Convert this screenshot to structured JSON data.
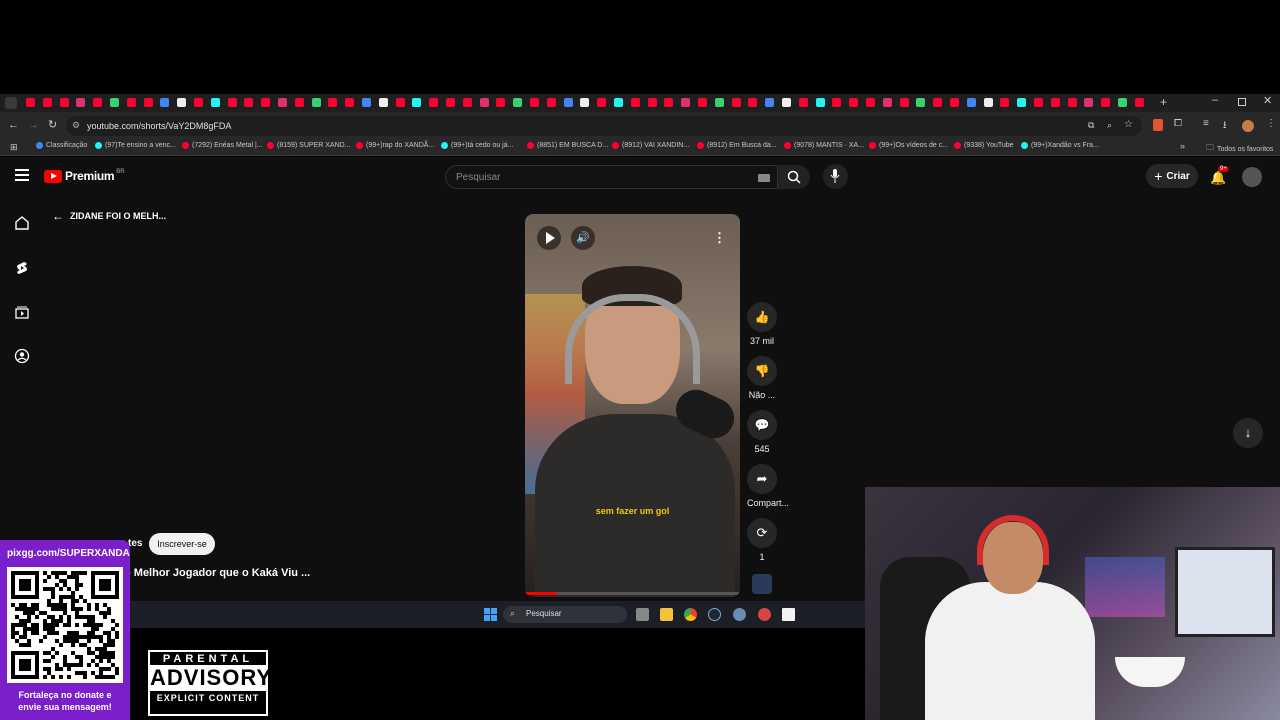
{
  "browser": {
    "url": "youtube.com/shorts/VaY2DM8gFDA",
    "bookmarks": [
      "Classificação",
      "(97)Te ensino a venc...",
      "(7292) Enéas Metal |...",
      "(8159) SUPER XAND...",
      "(99+)rap do XANDÃ...",
      "(99+)tá cedo ou já...",
      "(8851) EM BUSCA D...",
      "(8912) VAI XANDIN...",
      "(8912) Em Busca da...",
      "(9078) MANTIS · XA...",
      "(99+)Os vídeos de c...",
      "(9338) YouTube",
      "(99+)Xandão vs Fra..."
    ],
    "all_bookmarks": "Todos os favoritos",
    "more_bookmarks": "»"
  },
  "youtube": {
    "logo_text": "Premium",
    "region": "BR",
    "search_placeholder": "Pesquisar",
    "create_label": "Criar",
    "notif_badge": "9+",
    "back_title": "ZIDANE FOI O MELH...",
    "channel_suffix": "tes",
    "subscribe_label": "Inscrever-se",
    "video_title_partial": "o Melhor Jogador que o Kaká Viu ...",
    "subtitle": "sem fazer um gol",
    "actions": {
      "like_count": "37 mil",
      "dislike_label": "Não ...",
      "comment_count": "545",
      "share_label": "Compart...",
      "remix_count": "1"
    }
  },
  "taskbar": {
    "search_placeholder": "Pesquisar"
  },
  "overlay": {
    "donate_url": "pixgg.com/SUPERXANDA",
    "donate_text_1": "Fortaleça no donate e",
    "donate_text_2": "envie sua mensagem!",
    "advisory_1": "PARENTAL",
    "advisory_2": "ADVISORY",
    "advisory_3": "EXPLICIT CONTENT"
  },
  "colors": {
    "yt_red": "#ff0000",
    "accent_purple": "#7a1fc9",
    "subtitle_yellow": "#f5c518"
  }
}
